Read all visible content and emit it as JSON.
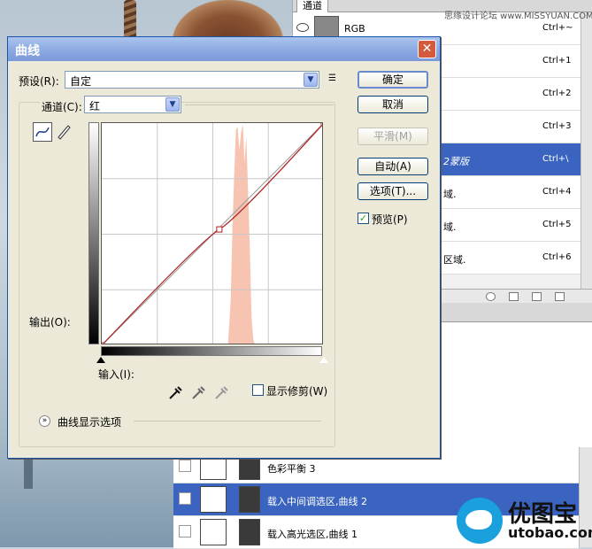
{
  "watermark": "思缘设计论坛 www.MISSYUAN.COM",
  "channels_panel": {
    "tab_label": "通道",
    "rows": [
      {
        "name": "RGB",
        "shortcut": "Ctrl+~",
        "selected": false
      },
      {
        "name": "",
        "shortcut": "Ctrl+1",
        "selected": false
      },
      {
        "name": "",
        "shortcut": "Ctrl+2",
        "selected": false
      },
      {
        "name": "",
        "shortcut": "Ctrl+3",
        "selected": false
      },
      {
        "name": "2蒙版",
        "shortcut": "Ctrl+\\",
        "selected": true
      },
      {
        "name": "域.",
        "shortcut": "Ctrl+4",
        "selected": false
      },
      {
        "name": "域.",
        "shortcut": "Ctrl+5",
        "selected": false
      },
      {
        "name": "区域.",
        "shortcut": "Ctrl+6",
        "selected": false
      }
    ]
  },
  "layers_panel": {
    "rows": [
      {
        "name": "色彩平衡 3",
        "selected": false
      },
      {
        "name": "载入中间调选区,曲线 2",
        "selected": true
      },
      {
        "name": "载入高光选区,曲线 1",
        "selected": false
      }
    ]
  },
  "logo": {
    "cn": "优图宝",
    "en": "utobao.com"
  },
  "dialog": {
    "title": "曲线",
    "close_glyph": "✕",
    "preset": {
      "label": "预设(R):",
      "value": "自定"
    },
    "channel": {
      "label": "通道(C):",
      "value": "红"
    },
    "buttons": {
      "ok": "确定",
      "cancel": "取消",
      "smooth": "平滑(M)",
      "auto": "自动(A)",
      "options": "选项(T)..."
    },
    "preview": {
      "label": "预览(P)",
      "checked": true
    },
    "output_label": "输出(O):",
    "input_label": "输入(I):",
    "show_clipping": {
      "label": "显示修剪(W)",
      "checked": false
    },
    "display_options_label": "曲线显示选项",
    "curve": {
      "points": [
        [
          0,
          0
        ],
        [
          135,
          133
        ],
        [
          255,
          255
        ]
      ]
    },
    "colors": {
      "histogram": "#f8c4b2",
      "curve": "#b02020",
      "selection": "#3a64c0"
    }
  }
}
